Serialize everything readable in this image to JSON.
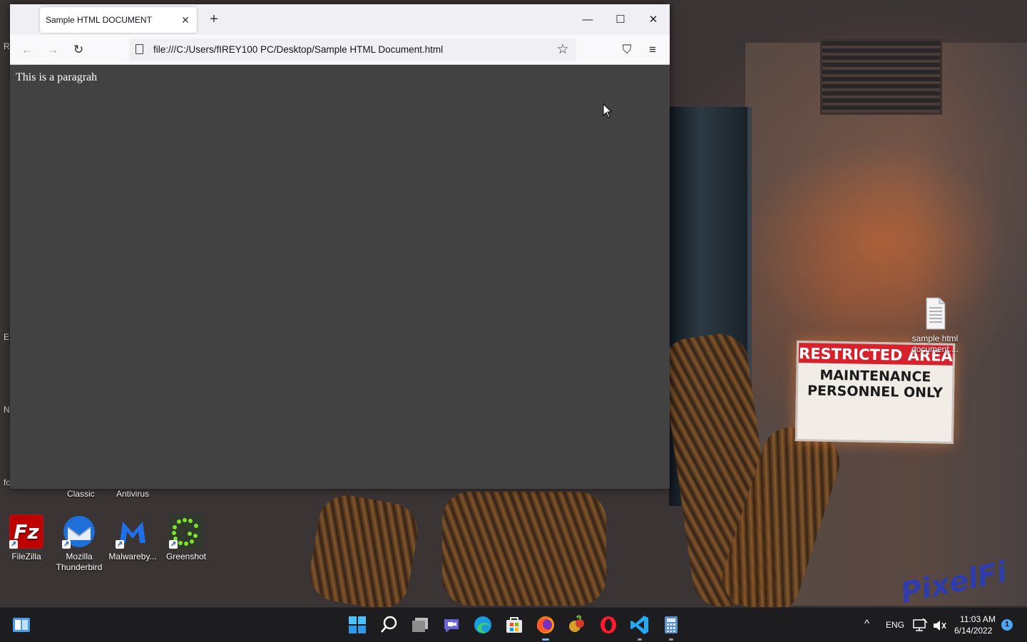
{
  "browser": {
    "tab_title": "Sample HTML DOCUMENT",
    "tab_close": "✕",
    "new_tab": "+",
    "url": "file:///C:/Users/fIREY100 PC/Desktop/Sample HTML Document.html",
    "window_controls": {
      "minimize": "—",
      "maximize": "☐",
      "close": "✕"
    },
    "nav": {
      "back": "←",
      "forward": "→",
      "reload": "↻",
      "star": "☆",
      "pocket": "⛉",
      "menu": "≡"
    },
    "page": {
      "paragraph": "This is a paragrah"
    },
    "background_color": "#424242"
  },
  "desktop": {
    "partial_labels": [
      "Classic",
      "Antivirus"
    ],
    "edge_letters": [
      "R",
      "E",
      "N",
      "fc"
    ],
    "icons": [
      {
        "label": "FileZilla",
        "icon": "filezilla-icon"
      },
      {
        "label": "Mozilla Thunderbird",
        "icon": "thunderbird-icon"
      },
      {
        "label": "Malwareby...",
        "icon": "malwarebytes-icon"
      },
      {
        "label": "Greenshot",
        "icon": "greenshot-icon"
      },
      {
        "label": "sample html document....",
        "icon": "text-document-icon"
      }
    ],
    "wallpaper": {
      "sign_top": "RESTRICTED AREA",
      "sign_bottom": "MAINTENANCE PERSONNEL ONLY",
      "watermark": "PixelFi"
    }
  },
  "taskbar": {
    "apps": [
      "start-icon",
      "search-icon",
      "task-view-icon",
      "chat-icon",
      "edge-icon",
      "store-icon",
      "firefox-icon",
      "app-icon",
      "opera-icon",
      "vscode-icon",
      "calculator-icon"
    ],
    "tray": {
      "chevron": "^",
      "language": "ENG",
      "time": "11:03 AM",
      "date": "6/14/2022",
      "notifications": "1"
    }
  }
}
